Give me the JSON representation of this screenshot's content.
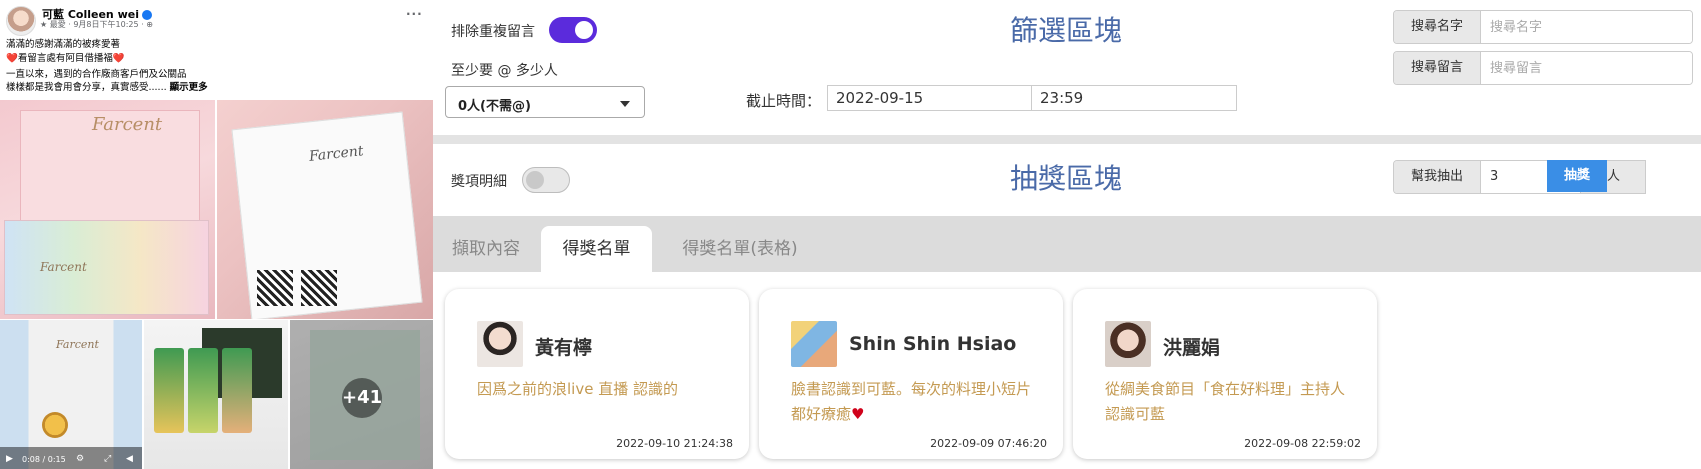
{
  "post": {
    "author": "可藍 Colleen wei",
    "meta": "★ 最愛 · 9月8日下午10:25 · ⊕",
    "more": "···",
    "lines": [
      "滿滿的感謝滿滿的被疼愛著",
      "❤️看留言處有阿目借播福❤️",
      "一直以來，遇到的合作廠商客戶們及公關品",
      "樣樣都是我會用會分享，真實感受...... "
    ],
    "see_more": "顯示更多",
    "photo_brand": "Farcent",
    "video_time": "0:08 / 0:15",
    "more_photos": "+41"
  },
  "filter": {
    "title": "篩選區塊",
    "dedupe_label": "排除重複留言",
    "dedupe_on": true,
    "mention_label": "至少要 @ 多少人",
    "mention_value": "0人(不需@)",
    "deadline_label": "截止時間：",
    "deadline_date": "2022-09-15",
    "deadline_time": "23:59",
    "search_name_label": "搜尋名字",
    "search_name_placeholder": "搜尋名字",
    "search_comment_label": "搜尋留言",
    "search_comment_placeholder": "搜尋留言"
  },
  "draw": {
    "title": "抽獎區塊",
    "detail_label": "獎項明細",
    "detail_on": false,
    "draw_prefix": "幫我抽出",
    "draw_count": "3",
    "draw_unit": "人",
    "draw_button": "抽獎"
  },
  "tabs": [
    {
      "label": "擷取內容",
      "active": false
    },
    {
      "label": "得獎名單",
      "active": true
    },
    {
      "label": "得獎名單(表格)",
      "active": false
    }
  ],
  "winners": [
    {
      "name": "黃有檸",
      "comment": "因爲之前的浪live 直播 認識的",
      "date": "2022-09-10 21:24:38"
    },
    {
      "name": "Shin Shin Hsiao",
      "comment": "臉書認識到可藍。每次的料理小短片都好療癒",
      "heart": "♥",
      "date": "2022-09-09 07:46:20"
    },
    {
      "name": "洪麗娟",
      "comment": "從綢美食節目「食在好料理」主持人認識可藍",
      "date": "2022-09-08 22:59:02"
    }
  ],
  "colors": {
    "accent_purple": "#5b2bdc",
    "title_blue": "#4a6aa8",
    "draw_button_blue": "#3a8ee6",
    "comment_gold": "#c49a52"
  }
}
